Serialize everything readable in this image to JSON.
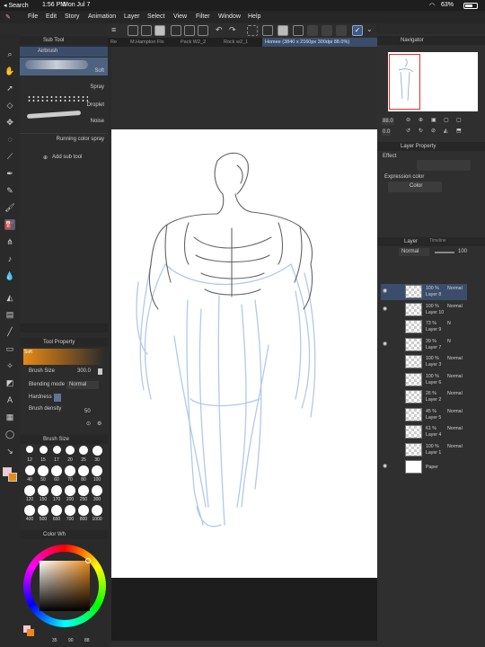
{
  "status": {
    "back": "◂ Search",
    "time": "1:56 PM",
    "date": "Mon Jul 7",
    "battery": "63%"
  },
  "menu": [
    "File",
    "Edit",
    "Story",
    "Animation",
    "Layer",
    "Select",
    "View",
    "Filter",
    "Window",
    "Help"
  ],
  "tabs": [
    "Re",
    "M.Hampton Flo",
    "Pack W2_2",
    "Rock w2_1",
    "Homee (3840 x 2160px 300dpi 88.0%)"
  ],
  "subtool": {
    "title": "Sub Tool",
    "header": "Airbrush",
    "items": [
      "Soft",
      "Spray",
      "Droplet",
      "Noise",
      "Running color spray"
    ],
    "add": "Add sub tool"
  },
  "toolprop": {
    "title": "Tool Property",
    "preview_label": "Soft",
    "brush_size_label": "Brush Size",
    "brush_size": "300.0",
    "blending_label": "Blending mode",
    "blending": "Normal",
    "hardness_label": "Hardness",
    "density_label": "Brush density",
    "density": "50"
  },
  "brushsize": {
    "title": "Brush Size",
    "sizes": [
      "12",
      "15",
      "17",
      "20",
      "25",
      "30",
      "40",
      "50",
      "60",
      "70",
      "80",
      "100",
      "120",
      "150",
      "170",
      "200",
      "250",
      "300",
      "400",
      "500",
      "600",
      "700",
      "800",
      "1000"
    ]
  },
  "colorwheel": {
    "title": "Color Wh",
    "values": [
      "35",
      "90",
      "88"
    ]
  },
  "navigator": {
    "title": "Navigator",
    "zoom": "88.0",
    "rotate": "0.0"
  },
  "layerprop": {
    "title": "Layer Property",
    "effect_label": "Effect",
    "expression_label": "Expression color",
    "expression": "Color"
  },
  "layerpanel": {
    "tab1": "Layer",
    "tab2": "Timeline",
    "blend": "Normal",
    "opacity": "100"
  },
  "layers": [
    {
      "pct": "100 %",
      "mode": "Normal",
      "name": "Layer 8",
      "selected": true,
      "eye": true
    },
    {
      "pct": "100 %",
      "mode": "Normal",
      "name": "Layer 10",
      "selected": false,
      "eye": true
    },
    {
      "pct": "73 %",
      "mode": "N",
      "name": "Layer 9",
      "selected": false,
      "eye": false
    },
    {
      "pct": "39 %",
      "mode": "N",
      "name": "Layer 7",
      "selected": false,
      "eye": true
    },
    {
      "pct": "100 %",
      "mode": "Normal",
      "name": "Layer 3",
      "selected": false,
      "eye": false
    },
    {
      "pct": "100 %",
      "mode": "Normal",
      "name": "Layer 6",
      "selected": false,
      "eye": false
    },
    {
      "pct": "26 %",
      "mode": "Normal",
      "name": "Layer 2",
      "selected": false,
      "eye": false
    },
    {
      "pct": "45 %",
      "mode": "Normal",
      "name": "Layer 5",
      "selected": false,
      "eye": false
    },
    {
      "pct": "61 %",
      "mode": "Normal",
      "name": "Layer 4",
      "selected": false,
      "eye": false
    },
    {
      "pct": "100 %",
      "mode": "Normal",
      "name": "Layer 1",
      "selected": false,
      "eye": false
    },
    {
      "pct": "",
      "mode": "",
      "name": "Paper",
      "selected": false,
      "eye": true
    }
  ],
  "colors": {
    "accent": "#3d5a80",
    "main_color": "#e8891a",
    "sub_color": "#f5c8d8",
    "sketch_blue": "#a9c4e6",
    "sketch_dark": "#4a4a4a"
  }
}
